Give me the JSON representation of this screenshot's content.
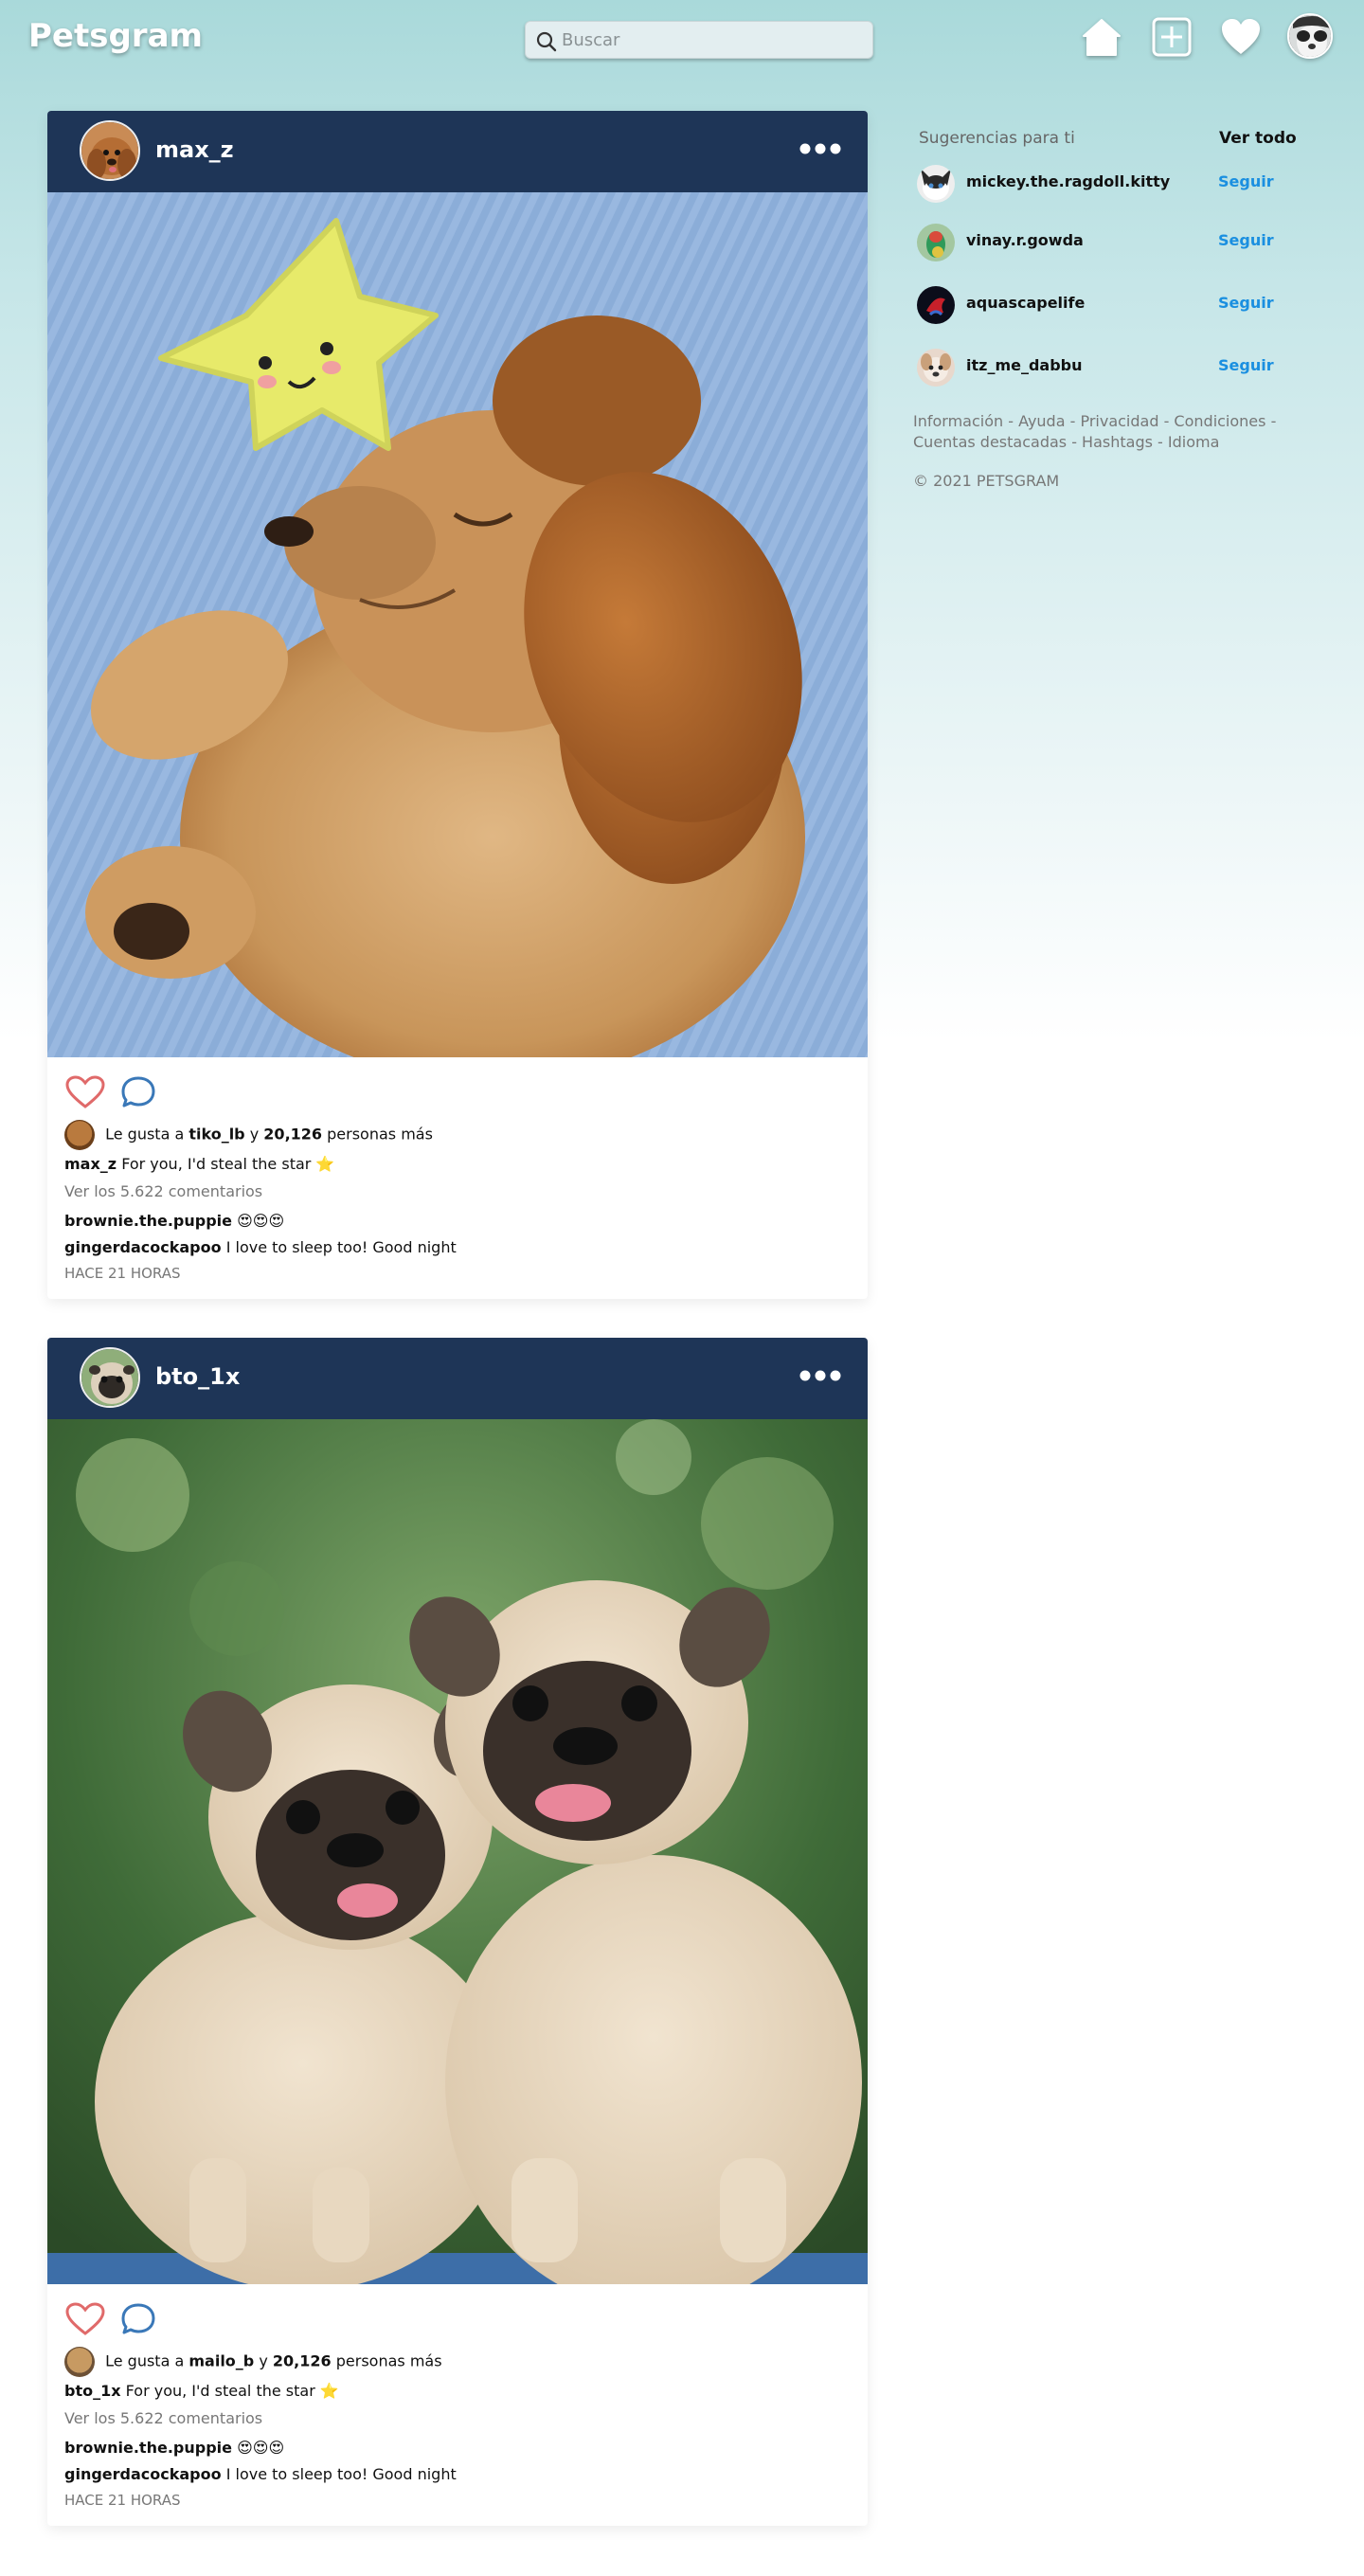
{
  "app": {
    "logo": "Petsgram"
  },
  "search": {
    "placeholder": "Buscar"
  },
  "nav": {
    "icons": [
      "home-icon",
      "add-post-icon",
      "heart-icon",
      "profile-avatar"
    ]
  },
  "posts": [
    {
      "username": "max_z",
      "image_alt": "Cocker spaniel puppy sleeping next to a yellow star plush toy",
      "likes_prefix": "Le gusta a",
      "likes_user": "tiko_lb",
      "likes_joiner": "y",
      "likes_count": "20,126",
      "likes_suffix": "personas más",
      "caption_user": "max_z",
      "caption_text": "For you, I'd steal the star ⭐",
      "view_comments": "Ver los 5.622 comentarios",
      "comments": [
        {
          "user": "brownie.the.puppie",
          "text": "😍😍😍"
        },
        {
          "user": "gingerdacockapoo",
          "text": "I love to sleep too! Good night"
        }
      ],
      "time": "HACE 21 HORAS"
    },
    {
      "username": "bto_1x",
      "image_alt": "Two pugs sitting together outdoors",
      "likes_prefix": "Le gusta a",
      "likes_user": "mailo_b",
      "likes_joiner": "y",
      "likes_count": "20,126",
      "likes_suffix": "personas más",
      "caption_user": "bto_1x",
      "caption_text": "For you, I'd steal the star ⭐",
      "view_comments": "Ver los 5.622 comentarios",
      "comments": [
        {
          "user": "brownie.the.puppie",
          "text": "😍😍😍"
        },
        {
          "user": "gingerdacockapoo",
          "text": "I love to sleep too! Good night"
        }
      ],
      "time": "HACE 21 HORAS"
    }
  ],
  "sidebar": {
    "title": "Sugerencias para ti",
    "view_all": "Ver todo",
    "suggestions": [
      {
        "name": "mickey.the.ragdoll.kitty",
        "follow": "Seguir"
      },
      {
        "name": "vinay.r.gowda",
        "follow": "Seguir"
      },
      {
        "name": "aquascapelife",
        "follow": "Seguir"
      },
      {
        "name": "itz_me_dabbu",
        "follow": "Seguir"
      }
    ],
    "links": "Información - Ayuda - Privacidad - Condiciones - Cuentas destacadas - Hashtags - Idioma",
    "copyright": "© 2021 PETSGRAM"
  },
  "colors": {
    "post_header": "#1e3557",
    "follow_link": "#1a8fe0",
    "like_heart": "#e06a6a",
    "comment_icon": "#3a78b8"
  }
}
